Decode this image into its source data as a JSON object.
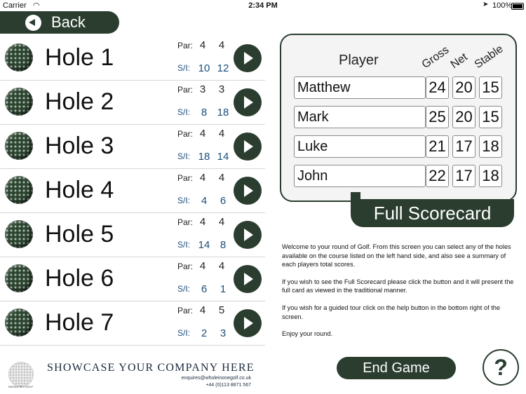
{
  "status_bar": {
    "carrier": "Carrier",
    "time": "2:34 PM",
    "battery": "100%"
  },
  "back_button": {
    "label": "Back"
  },
  "holes": [
    {
      "name": "Hole 1",
      "par_label": "Par:",
      "par": [
        "4",
        "4"
      ],
      "si_label": "S/I:",
      "si": [
        "10",
        "12"
      ]
    },
    {
      "name": "Hole 2",
      "par_label": "Par:",
      "par": [
        "3",
        "3"
      ],
      "si_label": "S/I:",
      "si": [
        "8",
        "18"
      ]
    },
    {
      "name": "Hole 3",
      "par_label": "Par:",
      "par": [
        "4",
        "4"
      ],
      "si_label": "S/I:",
      "si": [
        "18",
        "14"
      ]
    },
    {
      "name": "Hole 4",
      "par_label": "Par:",
      "par": [
        "4",
        "4"
      ],
      "si_label": "S/I:",
      "si": [
        "4",
        "6"
      ]
    },
    {
      "name": "Hole 5",
      "par_label": "Par:",
      "par": [
        "4",
        "4"
      ],
      "si_label": "S/I:",
      "si": [
        "14",
        "8"
      ]
    },
    {
      "name": "Hole 6",
      "par_label": "Par:",
      "par": [
        "4",
        "4"
      ],
      "si_label": "S/I:",
      "si": [
        "6",
        "1"
      ]
    },
    {
      "name": "Hole 7",
      "par_label": "Par:",
      "par": [
        "4",
        "5"
      ],
      "si_label": "S/I:",
      "si": [
        "2",
        "3"
      ]
    }
  ],
  "footer": {
    "logo_text": "WHOLE IN 1 GOLF",
    "showcase": "SHOWCASE YOUR COMPANY HERE",
    "email": "enquires@wholeinonegolf.co.uk",
    "phone": "+44 (0)113 8871 567"
  },
  "scorecard": {
    "headers": {
      "player": "Player",
      "gross": "Gross",
      "net": "Net",
      "stable": "Stable"
    },
    "players": [
      {
        "name": "Matthew",
        "gross": "24",
        "net": "20",
        "stable": "15"
      },
      {
        "name": "Mark",
        "gross": "25",
        "net": "20",
        "stable": "15"
      },
      {
        "name": "Luke",
        "gross": "21",
        "net": "17",
        "stable": "18"
      },
      {
        "name": "John",
        "gross": "22",
        "net": "17",
        "stable": "18"
      }
    ],
    "full_scorecard_label": "Full Scorecard"
  },
  "instructions": [
    "Welcome to your round of Golf. From this screen you can select any of the holes available on the course listed on the left hand side, and also see a summary of each players total scores.",
    "If you wish to see the Full Scorecard please click the button and it will present the full card as viewed in the traditional manner.",
    "If you wish for a guided tour click on the help button in the bottom right of the screen.",
    "Enjoy your round."
  ],
  "end_game": {
    "label": "End Game"
  },
  "help": {
    "label": "?"
  },
  "colors": {
    "primary": "#2a3d2e",
    "si_text": "#1b4e7a"
  }
}
